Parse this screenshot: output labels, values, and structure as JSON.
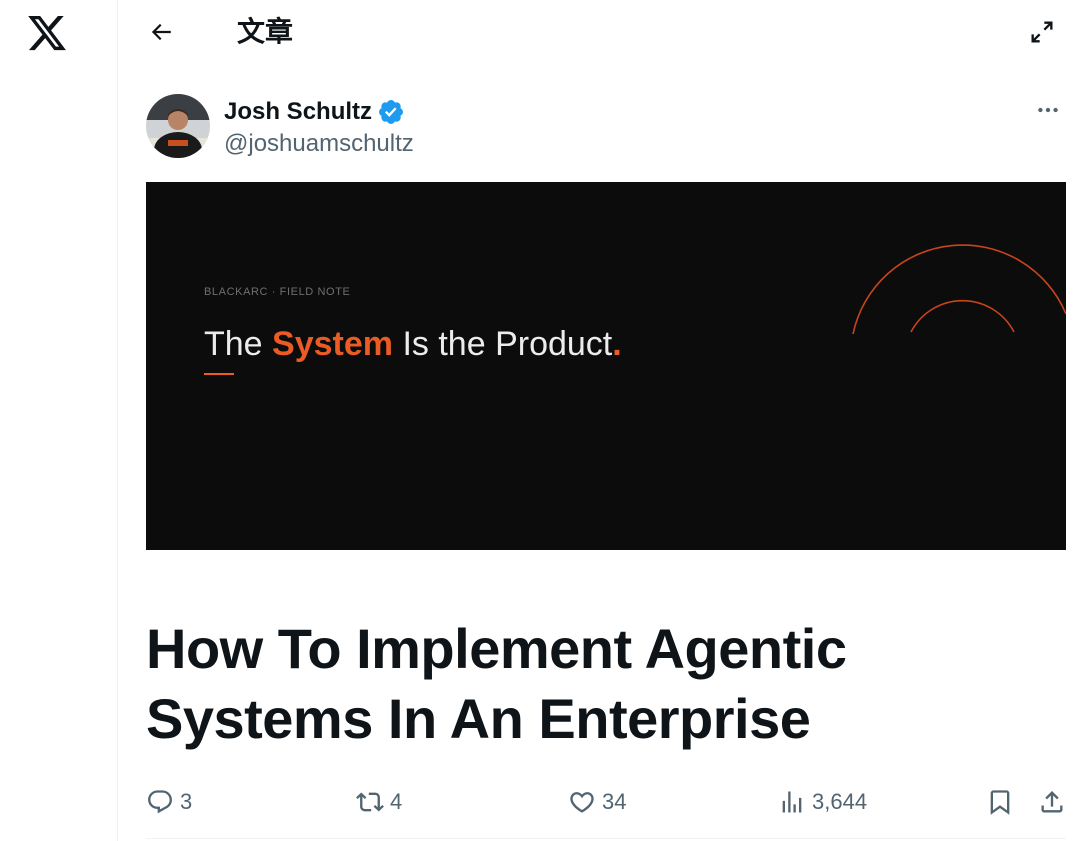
{
  "nav": {
    "logo_icon": "x-logo-icon"
  },
  "header": {
    "title": "文章",
    "back_icon": "arrow-left-icon",
    "expand_icon": "expand-icon"
  },
  "author": {
    "name": "Josh Schultz",
    "handle": "@joshuamschultz",
    "verified_icon": "verified-badge-icon",
    "more_icon": "more-horizontal-icon"
  },
  "cover": {
    "eyebrow": "BLACKARC · FIELD NOTE",
    "headline_before": "The ",
    "headline_accent": "System",
    "headline_after": " Is the Product",
    "headline_period": ".",
    "accent_color": "#ea5b25",
    "background_color": "#0c0c0d"
  },
  "article": {
    "title_line1": "How To Implement Agentic",
    "title_line2": "Systems In An Enterprise"
  },
  "actions": {
    "replies": "3",
    "reposts": "4",
    "likes": "34",
    "views": "3,644",
    "icons": [
      "reply-icon",
      "repost-icon",
      "like-icon",
      "views-icon",
      "bookmark-icon",
      "share-icon"
    ]
  },
  "colors": {
    "text_primary": "#0f1419",
    "text_secondary": "#536471",
    "verified_blue": "#1d9bf0"
  }
}
